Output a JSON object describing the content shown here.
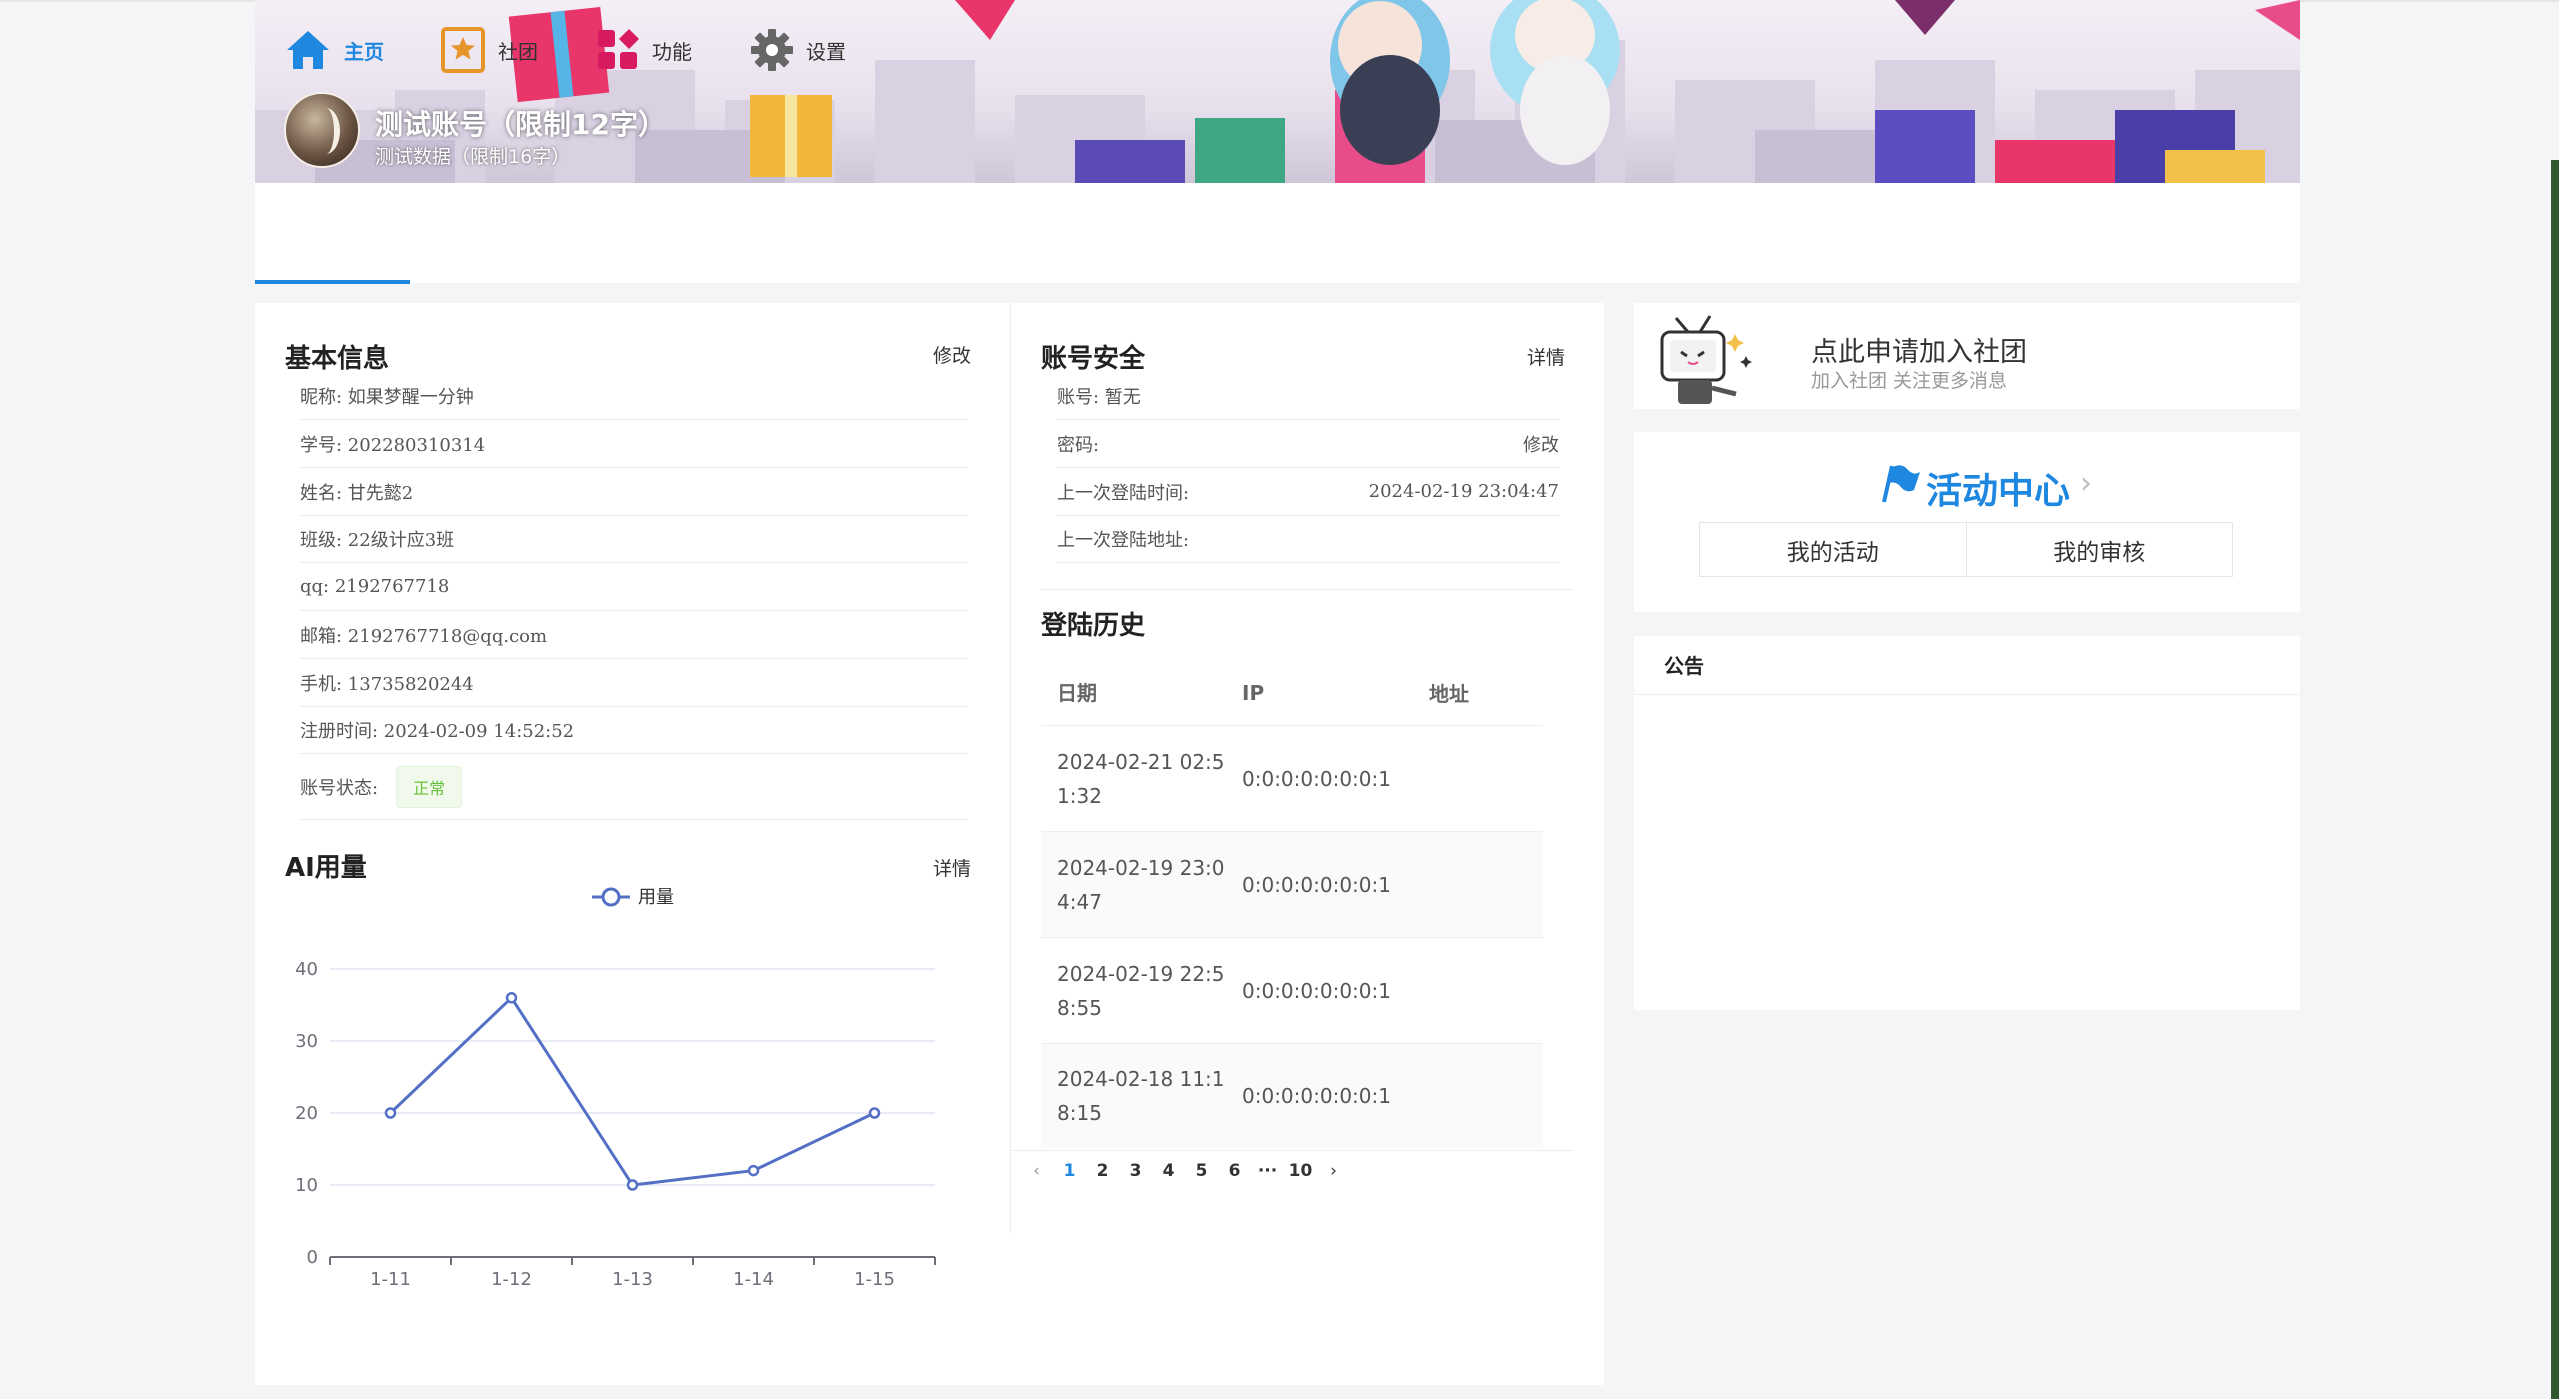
{
  "profile": {
    "account_name": "测试账号（限制12字）",
    "account_sub": "测试数据（限制16字）"
  },
  "nav": {
    "items": [
      {
        "label": "主页",
        "icon": "home-icon",
        "active": true
      },
      {
        "label": "社团",
        "icon": "club-star-icon",
        "active": false
      },
      {
        "label": "功能",
        "icon": "grid-shapes-icon",
        "active": false
      },
      {
        "label": "设置",
        "icon": "gear-icon",
        "active": false
      }
    ],
    "accent": "#1e87e0"
  },
  "basic_info": {
    "title": "基本信息",
    "edit_label": "修改",
    "rows": [
      {
        "text": "昵称: 如果梦醒一分钟"
      },
      {
        "text": "学号: 202280310314"
      },
      {
        "text": "姓名: 甘先懿2"
      },
      {
        "text": "班级: 22级计应3班"
      },
      {
        "text": "qq: 2192767718"
      },
      {
        "text": "邮箱: 2192767718@qq.com"
      },
      {
        "text": "手机: 13735820244"
      },
      {
        "text": "注册时间: 2024-02-09 14:52:52"
      }
    ],
    "status_label": "账号状态:",
    "status_value": "正常",
    "status_color": "#67c23a"
  },
  "ai_usage": {
    "title": "AI用量",
    "detail_label": "详情"
  },
  "chart_data": {
    "type": "line",
    "categories": [
      "1-11",
      "1-12",
      "1-13",
      "1-14",
      "1-15"
    ],
    "series": [
      {
        "name": "用量",
        "values": [
          20,
          36,
          10,
          12,
          20
        ],
        "color": "#5470c6"
      }
    ],
    "ylim": [
      0,
      40
    ],
    "yticks": [
      0,
      10,
      20,
      30,
      40
    ],
    "grid": true,
    "legend": "top-center"
  },
  "security": {
    "title": "账号安全",
    "detail_label": "详情",
    "account_label": "账号: 暂无",
    "password_label": "密码:",
    "password_action": "修改",
    "last_login_time_label": "上一次登陆时间:",
    "last_login_time": "2024-02-19 23:04:47",
    "last_login_addr_label": "上一次登陆地址:"
  },
  "login_history": {
    "title": "登陆历史",
    "columns": [
      "日期",
      "IP",
      "地址"
    ],
    "rows": [
      {
        "date_l1": "2024-02-21 02:5",
        "date_l2": "1:32",
        "ip": "0:0:0:0:0:0:0:1",
        "addr": ""
      },
      {
        "date_l1": "2024-02-19 23:0",
        "date_l2": "4:47",
        "ip": "0:0:0:0:0:0:0:1",
        "addr": ""
      },
      {
        "date_l1": "2024-02-19 22:5",
        "date_l2": "8:55",
        "ip": "0:0:0:0:0:0:0:1",
        "addr": ""
      },
      {
        "date_l1": "2024-02-18 11:1",
        "date_l2": "8:15",
        "ip": "0:0:0:0:0:0:0:1",
        "addr": ""
      }
    ],
    "pager": {
      "prev": "‹",
      "pages": [
        "1",
        "2",
        "3",
        "4",
        "5",
        "6",
        "···",
        "10"
      ],
      "current": "1",
      "next": "›"
    }
  },
  "join_club": {
    "title": "点此申请加入社团",
    "subtitle": "加入社团 关注更多消息"
  },
  "activity": {
    "title": "活动中心",
    "chevron": "›",
    "my_activities": "我的活动",
    "my_reviews": "我的审核"
  },
  "notice": {
    "title": "公告"
  }
}
